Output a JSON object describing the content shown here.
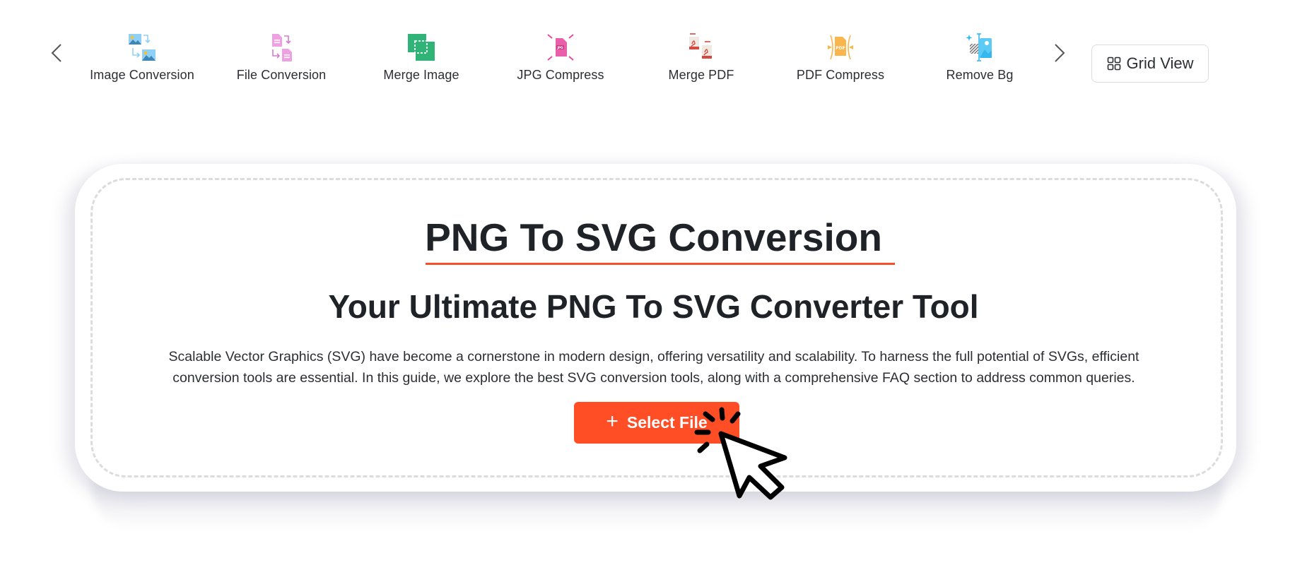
{
  "toolbar": {
    "prev_icon": "chevron-left-icon",
    "next_icon": "chevron-right-icon",
    "items": [
      {
        "label": "Image Conversion",
        "icon": "image-conversion-icon",
        "color": "#5bb8f0"
      },
      {
        "label": "File Conversion",
        "icon": "file-conversion-icon",
        "color": "#e585d8"
      },
      {
        "label": "Merge Image",
        "icon": "merge-image-icon",
        "color": "#2fb377"
      },
      {
        "label": "JPG Compress",
        "icon": "jpg-compress-icon",
        "color": "#e8459a"
      },
      {
        "label": "Merge PDF",
        "icon": "merge-pdf-icon",
        "color": "#d9473f"
      },
      {
        "label": "PDF Compress",
        "icon": "pdf-compress-icon",
        "color": "#f8b64c"
      },
      {
        "label": "Remove Bg",
        "icon": "remove-bg-icon",
        "color": "#35b8ee"
      }
    ],
    "grid_view_label": "Grid View",
    "grid_view_icon": "grid-icon"
  },
  "main": {
    "title": "PNG To SVG Conversion",
    "subtitle": "Your Ultimate PNG To SVG Converter Tool",
    "description": "Scalable Vector Graphics (SVG) have become a cornerstone in modern design, offering versatility and scalability. To harness the full potential of SVGs, efficient conversion tools are essential. In this guide, we explore the best SVG conversion tools, along with a comprehensive FAQ section to address common queries.",
    "select_button_label": "Select File",
    "select_button_icon": "plus-icon",
    "accent_color": "#ff4d26"
  }
}
